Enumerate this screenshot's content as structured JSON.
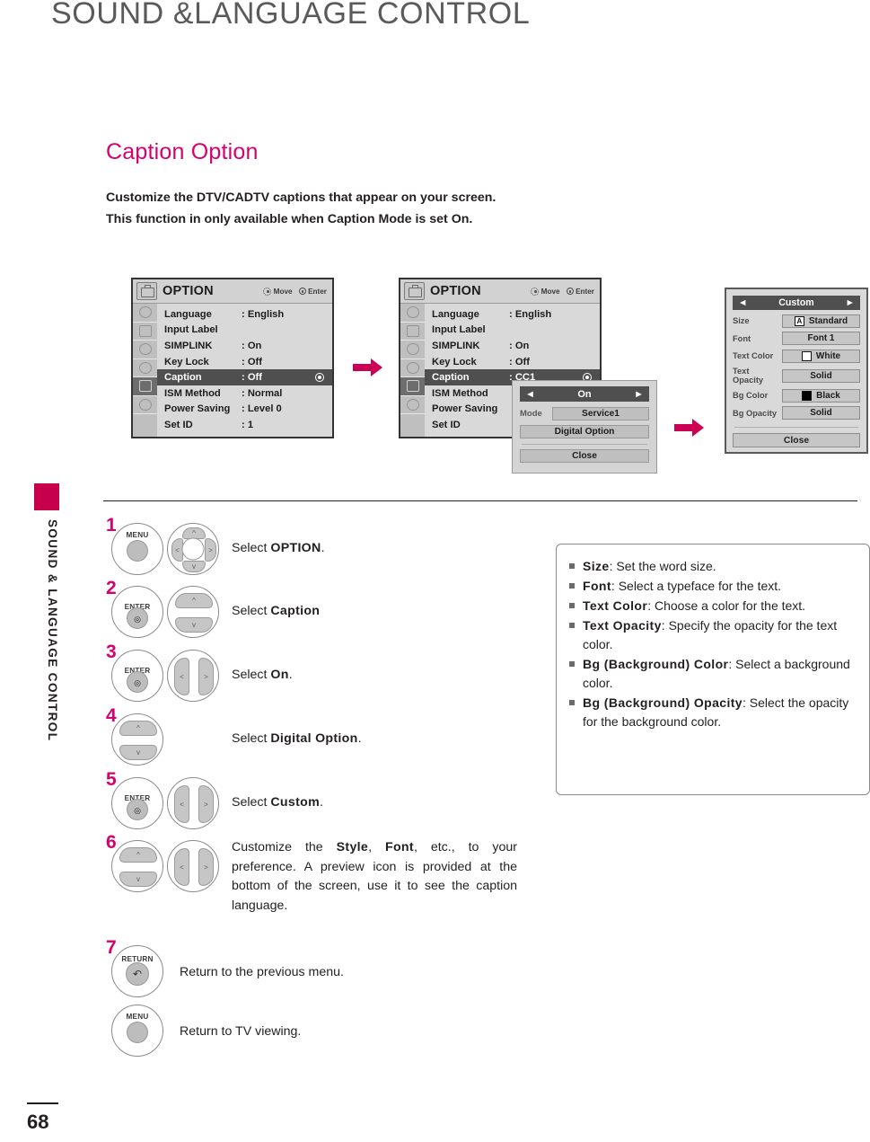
{
  "page": {
    "header_title": "SOUND &LANGUAGE CONTROL",
    "side_tab_text": "SOUND & LANGUAGE CONTROL",
    "page_number": "68",
    "accent_color": "#d6006e",
    "tab_color": "#c8004b"
  },
  "section": {
    "title": "Caption Option",
    "intro_line1": "Customize the DTV/CADTV captions that appear on your screen.",
    "intro_line2_a": "This function in only available when ",
    "intro_line2_b": "Caption",
    "intro_line2_c": " Mode is set ",
    "intro_line2_d": "On",
    "intro_line2_e": "."
  },
  "osd_common": {
    "title": "OPTION",
    "hint_move": "Move",
    "hint_enter": "Enter",
    "menu_icon": "option-toolbox-icon",
    "nav_icon": "dpad-icon",
    "enter_icon": "enter-dot-icon"
  },
  "osd_menu_1": {
    "rows": [
      {
        "label": "Language",
        "value": ": English",
        "selected": false
      },
      {
        "label": "Input Label",
        "value": "",
        "selected": false
      },
      {
        "label": "SIMPLINK",
        "value": ": On",
        "selected": false
      },
      {
        "label": "Key Lock",
        "value": ": Off",
        "selected": false
      },
      {
        "label": "Caption",
        "value": ": Off",
        "selected": true
      },
      {
        "label": "ISM Method",
        "value": ": Normal",
        "selected": false
      },
      {
        "label": "Power Saving",
        "value": ": Level 0",
        "selected": false
      },
      {
        "label": "Set ID",
        "value": ": 1",
        "selected": false
      }
    ]
  },
  "osd_menu_2": {
    "rows": [
      {
        "label": "Language",
        "value": ": English",
        "selected": false
      },
      {
        "label": "Input Label",
        "value": "",
        "selected": false
      },
      {
        "label": "SIMPLINK",
        "value": ": On",
        "selected": false
      },
      {
        "label": "Key Lock",
        "value": ": Off",
        "selected": false
      },
      {
        "label": "Caption",
        "value": ": CC1",
        "selected": true
      },
      {
        "label": "ISM Method",
        "value": "",
        "selected": false
      },
      {
        "label": "Power Saving",
        "value": "",
        "selected": false
      },
      {
        "label": "Set ID",
        "value": "",
        "selected": false
      }
    ]
  },
  "caption_popup": {
    "state": "On",
    "left_arrow": "◄",
    "right_arrow": "►",
    "mode_label": "Mode",
    "mode_value": "Service1",
    "digital_option": "Digital Option",
    "close": "Close"
  },
  "custom_panel": {
    "title": "Custom",
    "left_arrow": "◄",
    "right_arrow": "►",
    "rows": [
      {
        "label": "Size",
        "value": "Standard",
        "swatch": "letter-a",
        "swatch_text": "A"
      },
      {
        "label": "Font",
        "value": "Font 1",
        "swatch": "none",
        "swatch_text": ""
      },
      {
        "label": "Text Color",
        "value": "White",
        "swatch": "white",
        "swatch_text": ""
      },
      {
        "label": "Text Opacity",
        "value": "Solid",
        "swatch": "none",
        "swatch_text": ""
      },
      {
        "label": "Bg Color",
        "value": "Black",
        "swatch": "black",
        "swatch_text": ""
      },
      {
        "label": "Bg Opacity",
        "value": "Solid",
        "swatch": "none",
        "swatch_text": ""
      }
    ],
    "close": "Close"
  },
  "steps": [
    {
      "num": "1",
      "button_label": "MENU",
      "text_pre": "Select ",
      "text_bold": "OPTION",
      "text_post": "."
    },
    {
      "num": "2",
      "button_label": "ENTER",
      "text_pre": "Select ",
      "text_bold": "Caption",
      "text_post": ""
    },
    {
      "num": "3",
      "button_label": "ENTER",
      "text_pre": "Select ",
      "text_bold": "On",
      "text_post": "."
    },
    {
      "num": "4",
      "button_label": "",
      "text_pre": "Select ",
      "text_bold": "Digital Option",
      "text_post": "."
    },
    {
      "num": "5",
      "button_label": "ENTER",
      "text_pre": "Select ",
      "text_bold": "Custom",
      "text_post": "."
    },
    {
      "num": "6",
      "button_label": "",
      "text_pre": "Customize the ",
      "text_bold": "Style",
      "text_mid": ", ",
      "text_bold2": "Font",
      "text_post": ", etc., to your preference. A preview icon is provided at the bottom of the screen, use it to see the caption language."
    },
    {
      "num": "7",
      "button_label": "RETURN",
      "text_pre": "Return to the previous menu.",
      "text_bold": "",
      "text_post": ""
    },
    {
      "num": "",
      "button_label": "MENU",
      "text_pre": "Return to TV viewing.",
      "text_bold": "",
      "text_post": ""
    }
  ],
  "info_box": {
    "items": [
      {
        "term": "Size",
        "desc": ": Set the word size."
      },
      {
        "term": "Font",
        "desc": ": Select a typeface for the text."
      },
      {
        "term": "Text Color",
        "desc": ": Choose a color for the text."
      },
      {
        "term": "Text Opacity",
        "desc": ": Specify the opacity for the text color."
      },
      {
        "term": "Bg (Background) Color",
        "desc": ": Select a background color."
      },
      {
        "term": "Bg (Background) Opacity",
        "desc": ": Select the opacity for the background color."
      }
    ]
  },
  "arrows": {
    "flow_1": "right-arrow-icon",
    "flow_2": "right-arrow-icon"
  }
}
